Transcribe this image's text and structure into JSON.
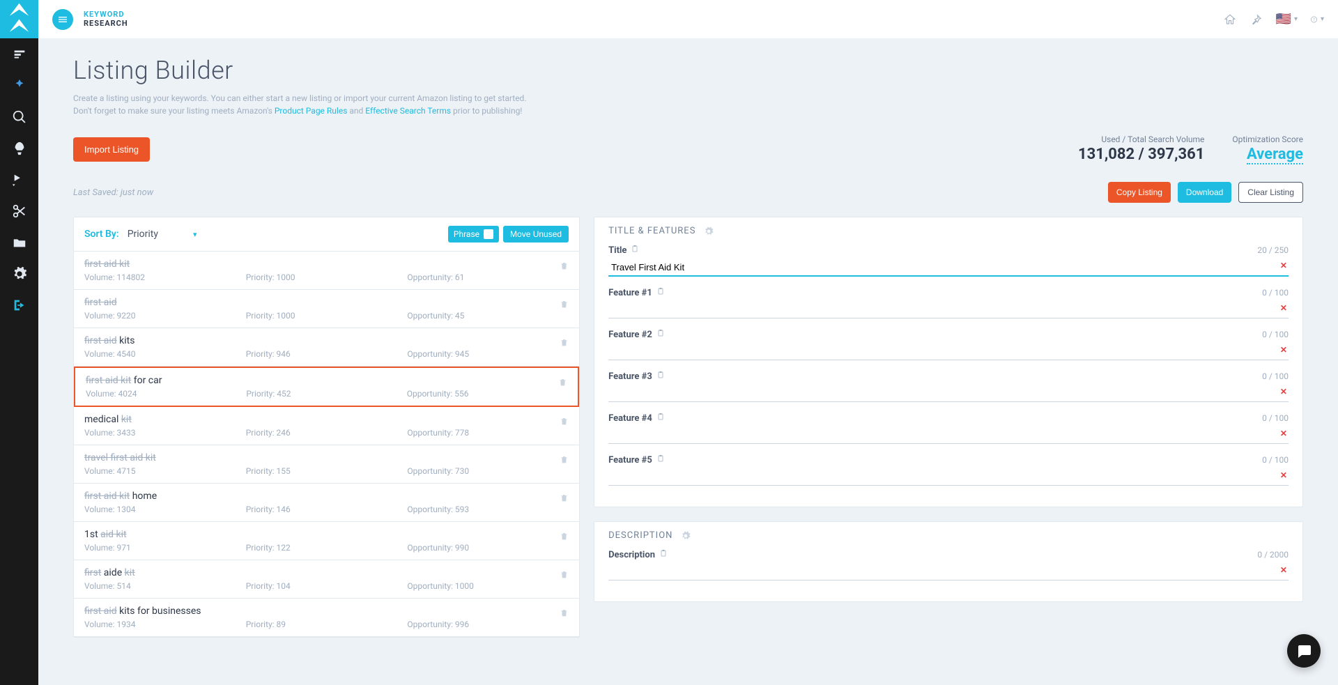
{
  "brand": {
    "top": "KEYWORD",
    "bot": "RESEARCH"
  },
  "page": {
    "title": "Listing Builder",
    "desc1": "Create a listing using your keywords. You can either start a new listing or import your current Amazon listing to get started.",
    "desc2a": "Don't forget to make sure your listing meets Amazon's ",
    "desc2b": "Product Page Rules",
    "desc2c": " and ",
    "desc2d": "Effective Search Terms",
    "desc2e": " prior to publishing!"
  },
  "import_btn": "Import Listing",
  "metrics": {
    "volume_label": "Used / Total Search Volume",
    "volume_value": "131,082 / 397,361",
    "opt_label": "Optimization Score",
    "opt_value": "Average"
  },
  "last_saved": "Last Saved: just now",
  "buttons": {
    "copy": "Copy Listing",
    "download": "Download",
    "clear": "Clear Listing"
  },
  "sort": {
    "label": "Sort By:",
    "value": "Priority"
  },
  "phrase_label": "Phrase",
  "move_unused": "Move Unused",
  "keywords": [
    {
      "parts": [
        {
          "t": "first aid kit",
          "u": true
        }
      ],
      "volume": "114802",
      "priority": "1000",
      "opportunity": "61",
      "hl": false
    },
    {
      "parts": [
        {
          "t": "first aid",
          "u": true
        }
      ],
      "volume": "9220",
      "priority": "1000",
      "opportunity": "45",
      "hl": false
    },
    {
      "parts": [
        {
          "t": "first aid",
          "u": true
        },
        {
          "t": " kits",
          "u": false
        }
      ],
      "volume": "4540",
      "priority": "946",
      "opportunity": "945",
      "hl": false
    },
    {
      "parts": [
        {
          "t": "first aid kit",
          "u": true
        },
        {
          "t": " for car",
          "u": false
        }
      ],
      "volume": "4024",
      "priority": "452",
      "opportunity": "556",
      "hl": true
    },
    {
      "parts": [
        {
          "t": "medical ",
          "u": false
        },
        {
          "t": "kit",
          "u": true
        }
      ],
      "volume": "3433",
      "priority": "246",
      "opportunity": "778",
      "hl": false
    },
    {
      "parts": [
        {
          "t": "travel first aid kit",
          "u": true
        }
      ],
      "volume": "4715",
      "priority": "155",
      "opportunity": "730",
      "hl": false
    },
    {
      "parts": [
        {
          "t": "first aid kit",
          "u": true
        },
        {
          "t": " home",
          "u": false
        }
      ],
      "volume": "1304",
      "priority": "146",
      "opportunity": "593",
      "hl": false
    },
    {
      "parts": [
        {
          "t": "1st ",
          "u": false
        },
        {
          "t": "aid kit",
          "u": true
        }
      ],
      "volume": "971",
      "priority": "122",
      "opportunity": "990",
      "hl": false
    },
    {
      "parts": [
        {
          "t": "first",
          "u": true
        },
        {
          "t": " aide ",
          "u": false
        },
        {
          "t": "kit",
          "u": true
        }
      ],
      "volume": "514",
      "priority": "104",
      "opportunity": "1000",
      "hl": false
    },
    {
      "parts": [
        {
          "t": "first aid",
          "u": true
        },
        {
          "t": " kits for businesses",
          "u": false
        }
      ],
      "volume": "1934",
      "priority": "89",
      "opportunity": "996",
      "hl": false
    }
  ],
  "stat_labels": {
    "volume": "Volume: ",
    "priority": "Priority: ",
    "opportunity": "Opportunity: "
  },
  "title_features": {
    "header": "TITLE & FEATURES",
    "title_label": "Title",
    "title_value": "Travel First Aid Kit",
    "title_limit": 250,
    "title_count": 20,
    "features": [
      {
        "label": "Feature #1",
        "count": 0,
        "limit": 100
      },
      {
        "label": "Feature #2",
        "count": 0,
        "limit": 100
      },
      {
        "label": "Feature #3",
        "count": 0,
        "limit": 100
      },
      {
        "label": "Feature #4",
        "count": 0,
        "limit": 100
      },
      {
        "label": "Feature #5",
        "count": 0,
        "limit": 100
      }
    ]
  },
  "description": {
    "header": "DESCRIPTION",
    "label": "Description",
    "count": 0,
    "limit": 2000
  }
}
